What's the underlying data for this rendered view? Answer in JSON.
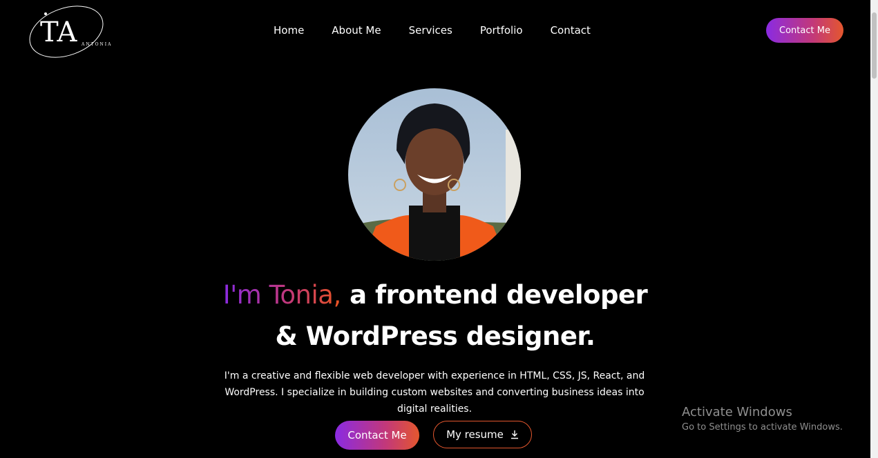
{
  "logo": {
    "monogram": "TA",
    "subtitle": "ANTONIA"
  },
  "nav": {
    "items": [
      {
        "label": "Home"
      },
      {
        "label": "About Me"
      },
      {
        "label": "Services"
      },
      {
        "label": "Portfolio"
      },
      {
        "label": "Contact"
      }
    ],
    "cta_label": "Contact Me"
  },
  "hero": {
    "greeting": "I'm Tonia,",
    "headline_rest": " a frontend developer",
    "headline_line2": "& WordPress designer.",
    "bio": "I'm a creative and flexible web developer with experience in HTML, CSS, JS, React, and WordPress. I specialize in building custom websites and converting business ideas into digital realities.",
    "primary_cta": "Contact Me",
    "secondary_cta": "My resume",
    "secondary_icon": "download-icon"
  },
  "watermark": {
    "title": "Activate Windows",
    "subtitle": "Go to Settings to activate Windows."
  },
  "colors": {
    "gradient_start": "#8a2be2",
    "gradient_end": "#e4572e",
    "background": "#000000"
  }
}
